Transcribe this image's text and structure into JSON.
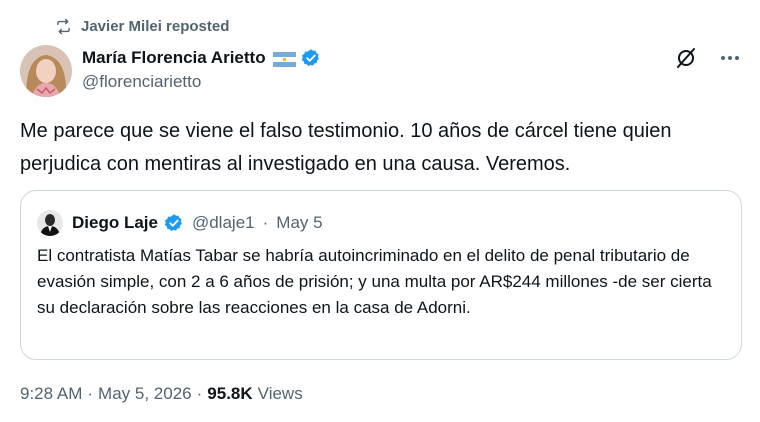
{
  "repost": {
    "label": "Javier Milei reposted",
    "icon": "repost-icon"
  },
  "author": {
    "name": "María Florencia Arietto",
    "handle": "@florenciarietto",
    "flag": "argentina-flag",
    "verified": true
  },
  "tweet": {
    "text": "Me parece que se viene el falso testimonio. 10 años de cárcel tiene quien perjudica con mentiras al investigado en una causa. Veremos."
  },
  "quote": {
    "name": "Diego Laje",
    "handle": "@dlaje1",
    "separator": "·",
    "date": "May 5",
    "text": "El contratista Matías Tabar se habría autoincriminado en el delito de penal tributario de evasión simple, con 2 a 6 años de prisión; y una multa por AR$244 millones -de ser cierta su declaración sobre las reacciones en la casa de Adorni."
  },
  "meta": {
    "time": "9:28 AM",
    "separator1": "·",
    "date": "May 5, 2026",
    "separator2": "·",
    "views_count": "95.8K",
    "views_label": "Views"
  },
  "colors": {
    "text": "#0f1419",
    "secondary": "#536471",
    "verified": "#1d9bf0",
    "border": "#cfd9de"
  }
}
